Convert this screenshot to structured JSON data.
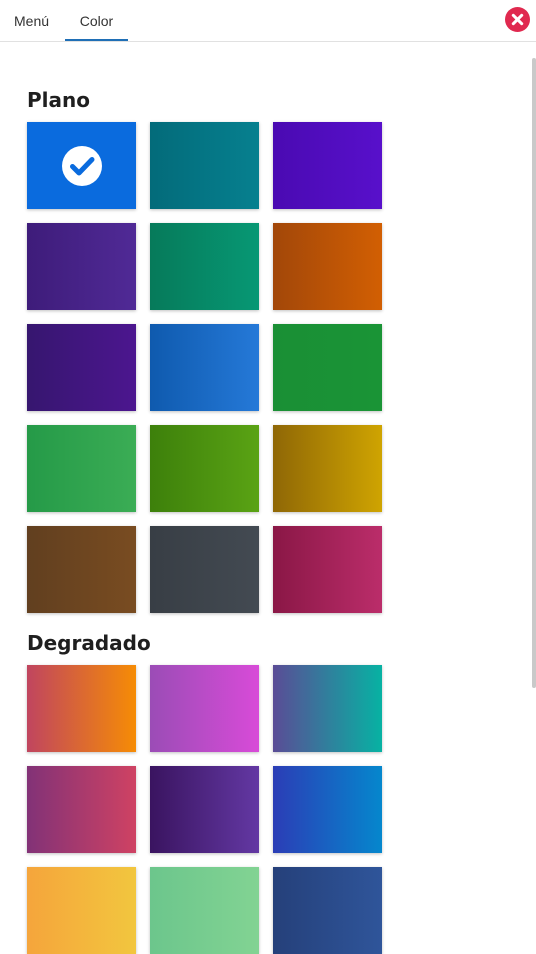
{
  "tabs": [
    {
      "label": "Menú"
    },
    {
      "label": "Color",
      "active": true
    }
  ],
  "close_icon": "close-icon",
  "sections": {
    "plain": {
      "title": "Plano",
      "swatches": [
        {
          "from": "#0a6bde",
          "to": "#0a6bde",
          "selected": true
        },
        {
          "from": "#036b7a",
          "to": "#06808f"
        },
        {
          "from": "#4a0ab2",
          "to": "#5810cb"
        },
        {
          "from": "#3e1c7a",
          "to": "#502a96"
        },
        {
          "from": "#067a5a",
          "to": "#079874"
        },
        {
          "from": "#a24709",
          "to": "#d25f03"
        },
        {
          "from": "#36166f",
          "to": "#4c168f"
        },
        {
          "from": "#0f5aae",
          "to": "#2579d8"
        },
        {
          "from": "#1a8f35",
          "to": "#1a9436"
        },
        {
          "from": "#259a48",
          "to": "#3bad55"
        },
        {
          "from": "#3d800b",
          "to": "#5aa314"
        },
        {
          "from": "#8f6706",
          "to": "#cfa401"
        },
        {
          "from": "#613f1f",
          "to": "#794c21"
        },
        {
          "from": "#383e45",
          "to": "#434a52"
        },
        {
          "from": "#8a1746",
          "to": "#bb2d6a"
        }
      ]
    },
    "gradient": {
      "title": "Degradado",
      "swatches": [
        {
          "from": "#c0455f",
          "to": "#f68c05"
        },
        {
          "from": "#9b4cb6",
          "to": "#d84bd8"
        },
        {
          "from": "#5a4c96",
          "to": "#07b2a3"
        },
        {
          "from": "#823277",
          "to": "#cf4263"
        },
        {
          "from": "#3a1460",
          "to": "#6338a3"
        },
        {
          "from": "#2b3db6",
          "to": "#0587cd"
        },
        {
          "from": "#f5a53c",
          "to": "#f2c63e"
        },
        {
          "from": "#6cc68c",
          "to": "#82d393"
        },
        {
          "from": "#25407a",
          "to": "#2f559a"
        }
      ]
    }
  }
}
